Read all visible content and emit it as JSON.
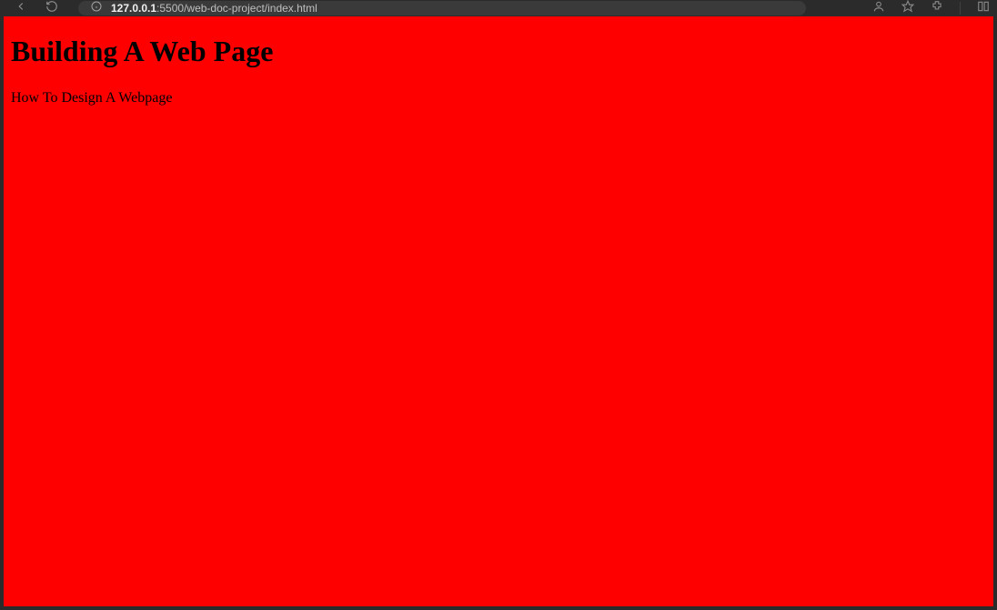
{
  "browser": {
    "url_host": "127.0.0.1",
    "url_rest": ":5500/web-doc-project/index.html"
  },
  "page": {
    "heading": "Building A Web Page",
    "paragraph": "How To Design A Webpage"
  }
}
